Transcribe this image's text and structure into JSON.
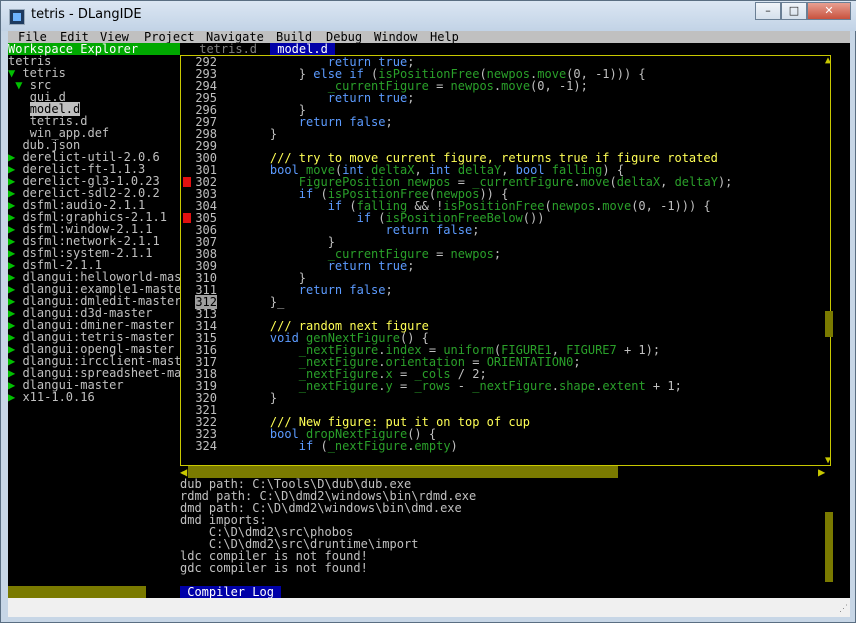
{
  "window": {
    "title": "tetris - DLangIDE",
    "controls": {
      "minimize": "–",
      "maximize": "□",
      "close": "✕"
    }
  },
  "menu": [
    "File",
    "Edit",
    "View",
    "Project",
    "Navigate",
    "Build",
    "Debug",
    "Window",
    "Help"
  ],
  "workspace": {
    "header": "Workspace Explorer",
    "tree": [
      {
        "text": "tetris",
        "arrow": "",
        "indent": 0
      },
      {
        "text": "tetris",
        "arrow": "▼",
        "indent": 0
      },
      {
        "text": "src",
        "arrow": "▼",
        "indent": 1
      },
      {
        "text": "gui.d",
        "arrow": "",
        "indent": 3
      },
      {
        "text": "model.d",
        "arrow": "",
        "indent": 3,
        "selected": true
      },
      {
        "text": "tetris.d",
        "arrow": "",
        "indent": 3
      },
      {
        "text": "win_app.def",
        "arrow": "",
        "indent": 3
      },
      {
        "text": "dub.json",
        "arrow": "",
        "indent": 2
      },
      {
        "text": "derelict-util-2.0.6",
        "arrow": "▶",
        "indent": 0
      },
      {
        "text": "derelict-ft-1.1.3",
        "arrow": "▶",
        "indent": 0
      },
      {
        "text": "derelict-gl3-1.0.23",
        "arrow": "▶",
        "indent": 0
      },
      {
        "text": "derelict-sdl2-2.0.2",
        "arrow": "▶",
        "indent": 0
      },
      {
        "text": "dsfml:audio-2.1.1",
        "arrow": "▶",
        "indent": 0
      },
      {
        "text": "dsfml:graphics-2.1.1",
        "arrow": "▶",
        "indent": 0
      },
      {
        "text": "dsfml:window-2.1.1",
        "arrow": "▶",
        "indent": 0
      },
      {
        "text": "dsfml:network-2.1.1",
        "arrow": "▶",
        "indent": 0
      },
      {
        "text": "dsfml:system-2.1.1",
        "arrow": "▶",
        "indent": 0
      },
      {
        "text": "dsfml-2.1.1",
        "arrow": "▶",
        "indent": 0
      },
      {
        "text": "dlangui:helloworld-mas",
        "arrow": "▶",
        "indent": 0
      },
      {
        "text": "dlangui:example1-maste",
        "arrow": "▶",
        "indent": 0
      },
      {
        "text": "dlangui:dmledit-master",
        "arrow": "▶",
        "indent": 0
      },
      {
        "text": "dlangui:d3d-master",
        "arrow": "▶",
        "indent": 0
      },
      {
        "text": "dlangui:dminer-master",
        "arrow": "▶",
        "indent": 0
      },
      {
        "text": "dlangui:tetris-master",
        "arrow": "▶",
        "indent": 0
      },
      {
        "text": "dlangui:opengl-master",
        "arrow": "▶",
        "indent": 0
      },
      {
        "text": "dlangui:ircclient-mast",
        "arrow": "▶",
        "indent": 0
      },
      {
        "text": "dlangui:spreadsheet-ma",
        "arrow": "▶",
        "indent": 0
      },
      {
        "text": "dlangui-master",
        "arrow": "▶",
        "indent": 0
      },
      {
        "text": "x11-1.0.16",
        "arrow": "▶",
        "indent": 0
      }
    ]
  },
  "tabs": [
    {
      "label": " tetris.d ",
      "active": false
    },
    {
      "label": " model.d ",
      "active": true
    }
  ],
  "editor": {
    "current_line": "312",
    "lines": [
      {
        "n": "292",
        "bp": false,
        "segs": [
          [
            "txt",
            "            "
          ],
          [
            "kw",
            "return true"
          ],
          [
            "txt",
            ";"
          ]
        ]
      },
      {
        "n": "293",
        "bp": false,
        "segs": [
          [
            "txt",
            "        } "
          ],
          [
            "kw",
            "else if"
          ],
          [
            "txt",
            " ("
          ],
          [
            "fn",
            "isPositionFree"
          ],
          [
            "txt",
            "("
          ],
          [
            "var",
            "newpos"
          ],
          [
            "txt",
            "."
          ],
          [
            "fn",
            "move"
          ],
          [
            "txt",
            "(0, -1))) {"
          ]
        ]
      },
      {
        "n": "294",
        "bp": false,
        "segs": [
          [
            "txt",
            "            "
          ],
          [
            "var",
            "_currentFigure"
          ],
          [
            "txt",
            " = "
          ],
          [
            "var",
            "newpos"
          ],
          [
            "txt",
            "."
          ],
          [
            "fn",
            "move"
          ],
          [
            "txt",
            "(0, -1);"
          ]
        ]
      },
      {
        "n": "295",
        "bp": false,
        "segs": [
          [
            "txt",
            "            "
          ],
          [
            "kw",
            "return true"
          ],
          [
            "txt",
            ";"
          ]
        ]
      },
      {
        "n": "296",
        "bp": false,
        "segs": [
          [
            "txt",
            "        }"
          ]
        ]
      },
      {
        "n": "297",
        "bp": false,
        "segs": [
          [
            "txt",
            "        "
          ],
          [
            "kw",
            "return false"
          ],
          [
            "txt",
            ";"
          ]
        ]
      },
      {
        "n": "298",
        "bp": false,
        "segs": [
          [
            "txt",
            "    }"
          ]
        ]
      },
      {
        "n": "299",
        "bp": false,
        "segs": [
          [
            "txt",
            ""
          ]
        ]
      },
      {
        "n": "300",
        "bp": false,
        "segs": [
          [
            "txt",
            "    "
          ],
          [
            "com",
            "/// try to move current figure, returns true if figure rotated"
          ]
        ]
      },
      {
        "n": "301",
        "bp": false,
        "segs": [
          [
            "txt",
            "    "
          ],
          [
            "ty",
            "bool"
          ],
          [
            "txt",
            " "
          ],
          [
            "fn",
            "move"
          ],
          [
            "txt",
            "("
          ],
          [
            "ty",
            "int"
          ],
          [
            "txt",
            " "
          ],
          [
            "var",
            "deltaX"
          ],
          [
            "txt",
            ", "
          ],
          [
            "ty",
            "int"
          ],
          [
            "txt",
            " "
          ],
          [
            "var",
            "deltaY"
          ],
          [
            "txt",
            ", "
          ],
          [
            "ty",
            "bool"
          ],
          [
            "txt",
            " "
          ],
          [
            "var",
            "falling"
          ],
          [
            "txt",
            ") {"
          ]
        ]
      },
      {
        "n": "302",
        "bp": true,
        "segs": [
          [
            "txt",
            "        "
          ],
          [
            "fn",
            "FigurePosition"
          ],
          [
            "txt",
            " "
          ],
          [
            "var",
            "newpos"
          ],
          [
            "txt",
            " = "
          ],
          [
            "var",
            "_currentFigure"
          ],
          [
            "txt",
            "."
          ],
          [
            "fn",
            "move"
          ],
          [
            "txt",
            "("
          ],
          [
            "var",
            "deltaX"
          ],
          [
            "txt",
            ", "
          ],
          [
            "var",
            "deltaY"
          ],
          [
            "txt",
            ");"
          ]
        ]
      },
      {
        "n": "303",
        "bp": false,
        "segs": [
          [
            "txt",
            "        "
          ],
          [
            "kw",
            "if"
          ],
          [
            "txt",
            " ("
          ],
          [
            "fn",
            "isPositionFree"
          ],
          [
            "txt",
            "("
          ],
          [
            "var",
            "newpos"
          ],
          [
            "txt",
            ")) {"
          ]
        ]
      },
      {
        "n": "304",
        "bp": false,
        "segs": [
          [
            "txt",
            "            "
          ],
          [
            "kw",
            "if"
          ],
          [
            "txt",
            " ("
          ],
          [
            "var",
            "falling"
          ],
          [
            "txt",
            " && !"
          ],
          [
            "fn",
            "isPositionFree"
          ],
          [
            "txt",
            "("
          ],
          [
            "var",
            "newpos"
          ],
          [
            "txt",
            "."
          ],
          [
            "fn",
            "move"
          ],
          [
            "txt",
            "(0, -1))) {"
          ]
        ]
      },
      {
        "n": "305",
        "bp": true,
        "segs": [
          [
            "txt",
            "                "
          ],
          [
            "kw",
            "if"
          ],
          [
            "txt",
            " ("
          ],
          [
            "fn",
            "isPositionFreeBelow"
          ],
          [
            "txt",
            "())"
          ]
        ]
      },
      {
        "n": "306",
        "bp": false,
        "segs": [
          [
            "txt",
            "                    "
          ],
          [
            "kw",
            "return false"
          ],
          [
            "txt",
            ";"
          ]
        ]
      },
      {
        "n": "307",
        "bp": false,
        "segs": [
          [
            "txt",
            "            }"
          ]
        ]
      },
      {
        "n": "308",
        "bp": false,
        "segs": [
          [
            "txt",
            "            "
          ],
          [
            "var",
            "_currentFigure"
          ],
          [
            "txt",
            " = "
          ],
          [
            "var",
            "newpos"
          ],
          [
            "txt",
            ";"
          ]
        ]
      },
      {
        "n": "309",
        "bp": false,
        "segs": [
          [
            "txt",
            "            "
          ],
          [
            "kw",
            "return true"
          ],
          [
            "txt",
            ";"
          ]
        ]
      },
      {
        "n": "310",
        "bp": false,
        "segs": [
          [
            "txt",
            "        }"
          ]
        ]
      },
      {
        "n": "311",
        "bp": false,
        "segs": [
          [
            "txt",
            "        "
          ],
          [
            "kw",
            "return false"
          ],
          [
            "txt",
            ";"
          ]
        ]
      },
      {
        "n": "312",
        "bp": false,
        "segs": [
          [
            "txt",
            "    }_"
          ]
        ]
      },
      {
        "n": "313",
        "bp": false,
        "segs": [
          [
            "txt",
            ""
          ]
        ]
      },
      {
        "n": "314",
        "bp": false,
        "segs": [
          [
            "txt",
            "    "
          ],
          [
            "com",
            "/// random next figure"
          ]
        ]
      },
      {
        "n": "315",
        "bp": false,
        "segs": [
          [
            "txt",
            "    "
          ],
          [
            "ty",
            "void"
          ],
          [
            "txt",
            " "
          ],
          [
            "fn",
            "genNextFigure"
          ],
          [
            "txt",
            "() {"
          ]
        ]
      },
      {
        "n": "316",
        "bp": false,
        "segs": [
          [
            "txt",
            "        "
          ],
          [
            "var",
            "_nextFigure"
          ],
          [
            "txt",
            "."
          ],
          [
            "var",
            "index"
          ],
          [
            "txt",
            " = "
          ],
          [
            "fn",
            "uniform"
          ],
          [
            "txt",
            "("
          ],
          [
            "var",
            "FIGURE1"
          ],
          [
            "txt",
            ", "
          ],
          [
            "var",
            "FIGURE7"
          ],
          [
            "txt",
            " + 1);"
          ]
        ]
      },
      {
        "n": "317",
        "bp": false,
        "segs": [
          [
            "txt",
            "        "
          ],
          [
            "var",
            "_nextFigure"
          ],
          [
            "txt",
            "."
          ],
          [
            "var",
            "orientation"
          ],
          [
            "txt",
            " = "
          ],
          [
            "var",
            "ORIENTATION0"
          ],
          [
            "txt",
            ";"
          ]
        ]
      },
      {
        "n": "318",
        "bp": false,
        "segs": [
          [
            "txt",
            "        "
          ],
          [
            "var",
            "_nextFigure"
          ],
          [
            "txt",
            "."
          ],
          [
            "var",
            "x"
          ],
          [
            "txt",
            " = "
          ],
          [
            "var",
            "_cols"
          ],
          [
            "txt",
            " / 2;"
          ]
        ]
      },
      {
        "n": "319",
        "bp": false,
        "segs": [
          [
            "txt",
            "        "
          ],
          [
            "var",
            "_nextFigure"
          ],
          [
            "txt",
            "."
          ],
          [
            "var",
            "y"
          ],
          [
            "txt",
            " = "
          ],
          [
            "var",
            "_rows"
          ],
          [
            "txt",
            " - "
          ],
          [
            "var",
            "_nextFigure"
          ],
          [
            "txt",
            "."
          ],
          [
            "var",
            "shape"
          ],
          [
            "txt",
            "."
          ],
          [
            "var",
            "extent"
          ],
          [
            "txt",
            " + 1;"
          ]
        ]
      },
      {
        "n": "320",
        "bp": false,
        "segs": [
          [
            "txt",
            "    }"
          ]
        ]
      },
      {
        "n": "321",
        "bp": false,
        "segs": [
          [
            "txt",
            ""
          ]
        ]
      },
      {
        "n": "322",
        "bp": false,
        "segs": [
          [
            "txt",
            "    "
          ],
          [
            "com",
            "/// New figure: put it on top of cup"
          ]
        ]
      },
      {
        "n": "323",
        "bp": false,
        "segs": [
          [
            "txt",
            "    "
          ],
          [
            "ty",
            "bool"
          ],
          [
            "txt",
            " "
          ],
          [
            "fn",
            "dropNextFigure"
          ],
          [
            "txt",
            "() {"
          ]
        ]
      },
      {
        "n": "324",
        "bp": false,
        "segs": [
          [
            "txt",
            "        "
          ],
          [
            "kw",
            "if"
          ],
          [
            "txt",
            " ("
          ],
          [
            "var",
            "_nextFigure"
          ],
          [
            "txt",
            "."
          ],
          [
            "var",
            "empty"
          ],
          [
            "txt",
            ")"
          ]
        ]
      }
    ]
  },
  "log": {
    "lines": [
      "dub path: C:\\Tools\\D\\dub\\dub.exe",
      "rdmd path: C:\\D\\dmd2\\windows\\bin\\rdmd.exe",
      "dmd path: C:\\D\\dmd2\\windows\\bin\\dmd.exe",
      "dmd imports:",
      "    C:\\D\\dmd2\\src\\phobos",
      "    C:\\D\\dmd2\\src\\druntime\\import",
      "ldc compiler is not found!",
      "gdc compiler is not found!"
    ],
    "tab_label": " Compiler Log "
  },
  "colors": {
    "accent_green": "#00a800",
    "tab_blue": "#0000a8",
    "scroll_olive": "#7a7a00",
    "breakpoint_red": "#e01010"
  }
}
